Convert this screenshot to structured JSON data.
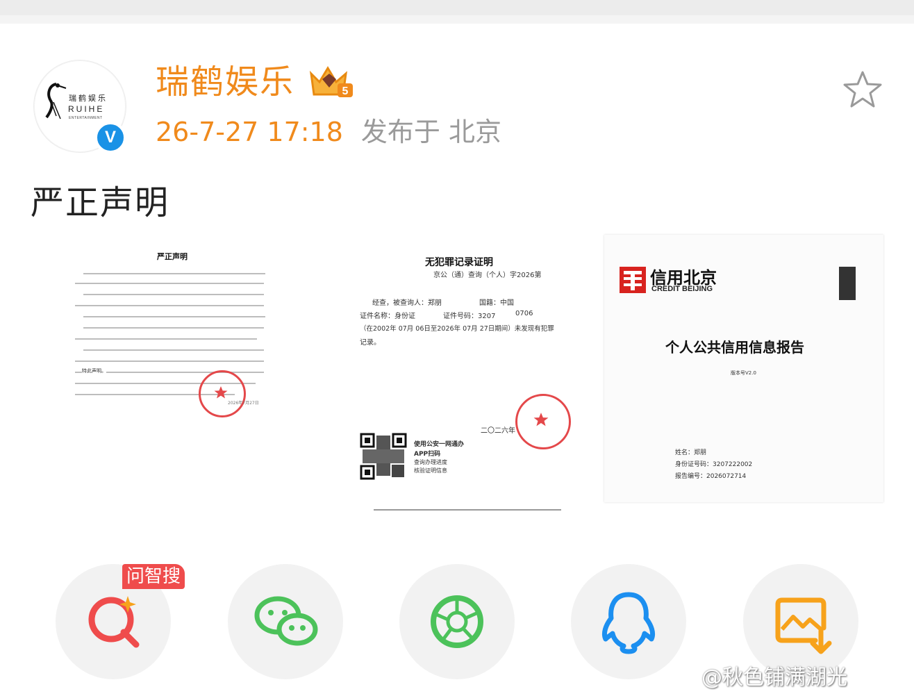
{
  "post": {
    "username": "瑞鹤娱乐",
    "level_badge": "5",
    "verified_mark": "V",
    "time": "26-7-27 17:18",
    "location": "发布于 北京",
    "title": "严正声明",
    "avatar": {
      "logo_cn": "瑞鹤娱乐",
      "logo_en": "RUIHE",
      "logo_sub": "ENTERTAINMENT"
    }
  },
  "images": {
    "statement": {
      "heading": "严正声明",
      "closing": "特此声明。",
      "signature": "2026年7月27日"
    },
    "no_record": {
      "heading": "无犯罪记录证明",
      "ref": "京公（通）查询（个人）字2026第",
      "line1": "经查，被查询人：郑朋",
      "nationality": "国籍：中国",
      "line2": "证件名称：身份证",
      "idno": "证件号码：3207",
      "idno_tail": "0706",
      "line3": "（在2002年 07月 06日至2026年 07月 27日期间）未发现有犯罪",
      "line4": "记录。",
      "date": "二〇二六年",
      "qr1": "使用公安一网通办",
      "qr2": "APP扫码",
      "qr3": "查询办理进度",
      "qr4": "核验证明信息"
    },
    "credit": {
      "brand_cn": "信用北京",
      "brand_en": "CREDIT BEIJING",
      "heading": "个人公共信用信息报告",
      "version": "版本号V2.0",
      "name": "姓名：郑朋",
      "id": "身份证号码：3207222002",
      "report": "报告编号：2026072714"
    }
  },
  "share": {
    "tag": "问智搜",
    "items": [
      "smart-search",
      "wechat",
      "moments",
      "qq",
      "save-image"
    ]
  },
  "watermark": "@秋色铺满湖光",
  "colors": {
    "accent": "#f08a1c",
    "verified": "#1a92e6",
    "tag": "#ef4c4c",
    "wechat": "#4cc25a",
    "qq": "#1c8ff0",
    "save": "#f7a21b"
  }
}
